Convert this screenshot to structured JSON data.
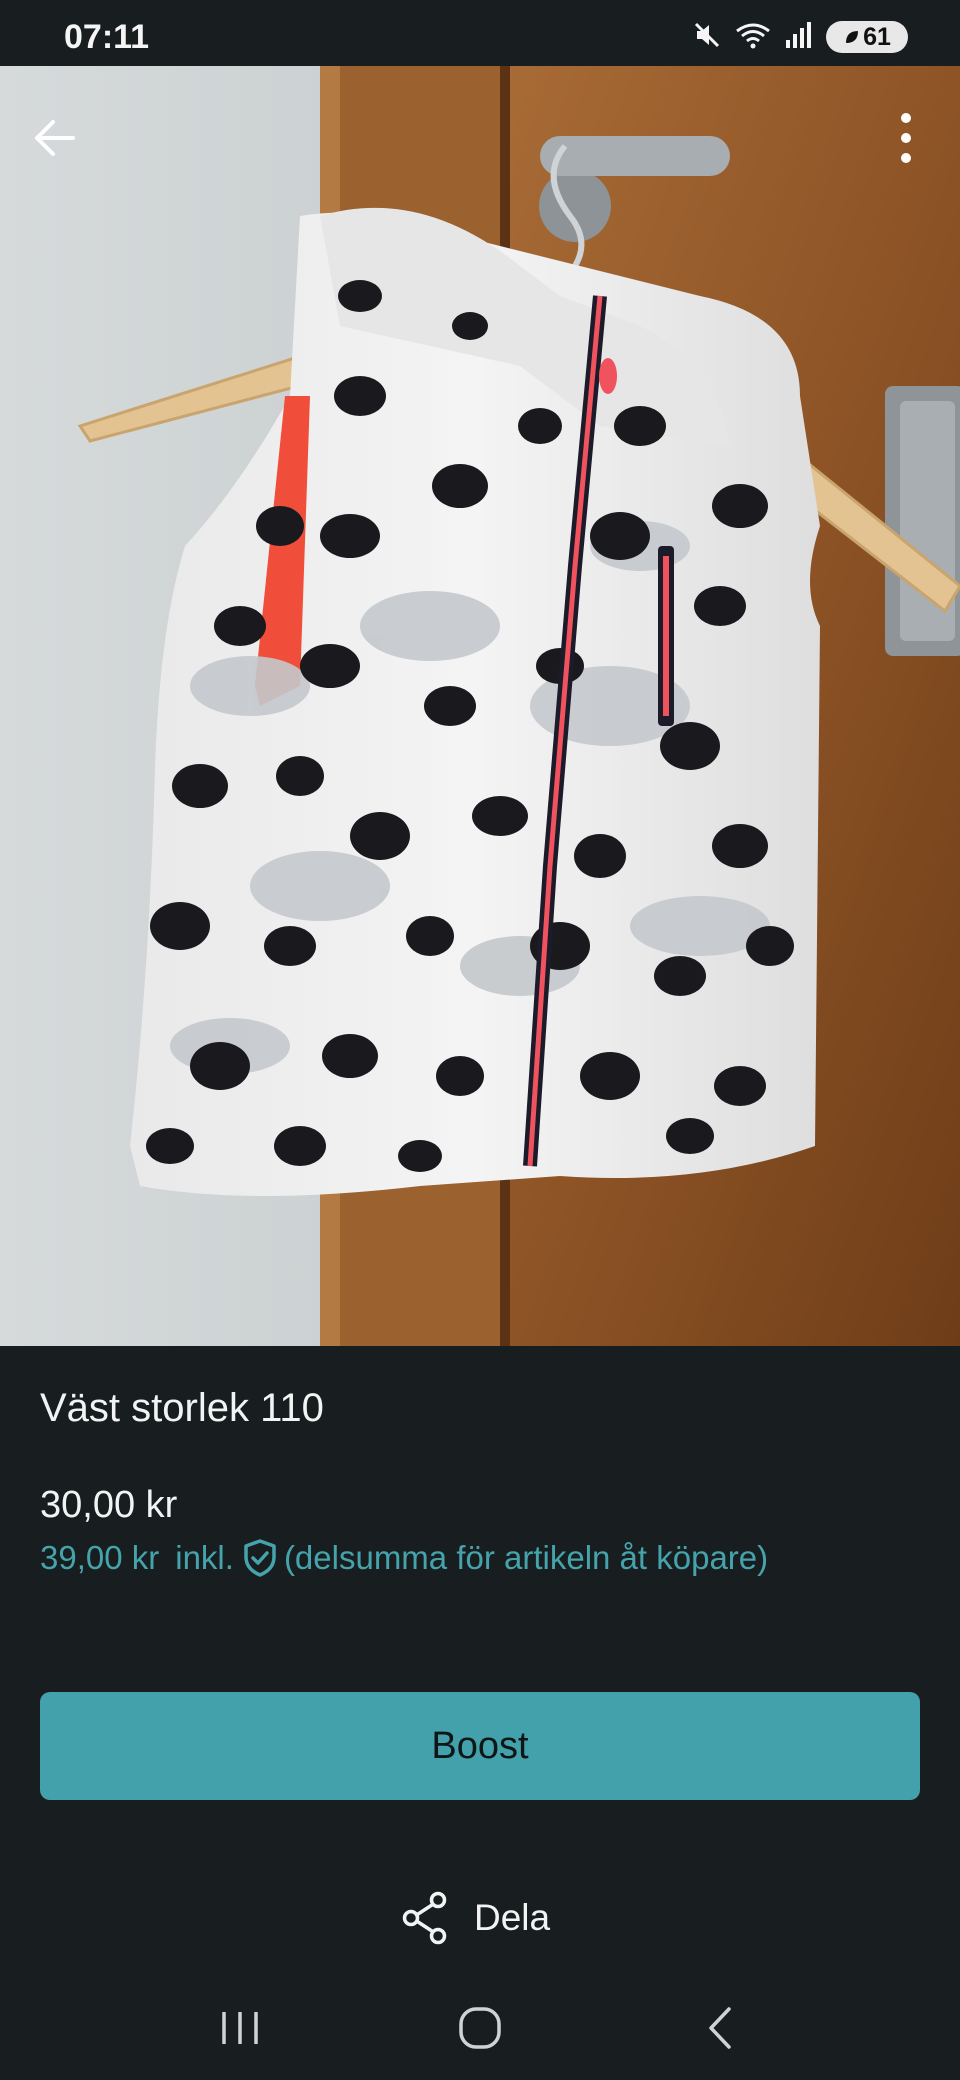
{
  "status_bar": {
    "time": "07:11",
    "battery": "61",
    "icons": [
      "mute-icon",
      "wifi-icon",
      "signal-icon",
      "battery-icon"
    ]
  },
  "top_bar": {
    "back_icon": "arrow-left-icon",
    "menu_icon": "more-vertical-icon"
  },
  "gallery": {
    "image_count": 5,
    "current_index": 1
  },
  "listing": {
    "title": "Väst storlek 110",
    "price": "30,00 kr",
    "price_incl": "39,00 kr",
    "incl_label": "inkl.",
    "incl_note": "(delsumma för artikeln åt köpare)",
    "incl_icon": "shield-check-icon"
  },
  "actions": {
    "boost_label": "Boost",
    "share_label": "Dela",
    "share_icon": "share-icon"
  },
  "nav_bar": {
    "icons": [
      "recents-icon",
      "home-icon",
      "back-icon"
    ]
  },
  "colors": {
    "background": "#181e1f",
    "accent": "#43a1ab",
    "accent_text": "#45a3ac"
  }
}
